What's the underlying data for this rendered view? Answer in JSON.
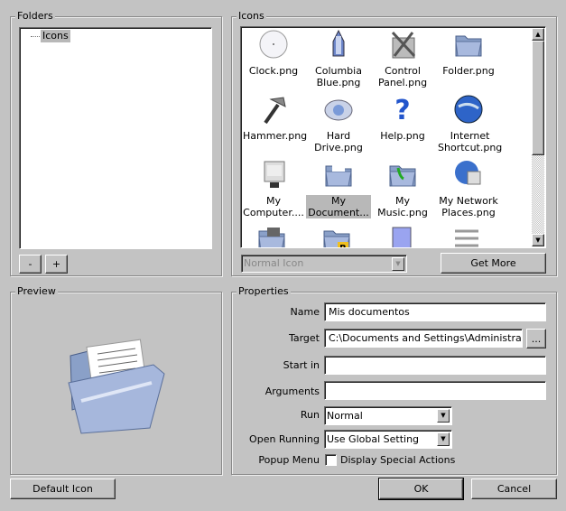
{
  "folders": {
    "title": "Folders",
    "tree": [
      "Icons"
    ],
    "remove_label": "-",
    "add_label": "+"
  },
  "icons": {
    "title": "Icons",
    "items": [
      {
        "label": "Clock.png",
        "icon": "clock-icon"
      },
      {
        "label": "Columbia Blue.png",
        "icon": "shuttle-icon"
      },
      {
        "label": "Control Panel.png",
        "icon": "control-panel-icon"
      },
      {
        "label": "Folder.png",
        "icon": "folder-icon"
      },
      {
        "label": "Hammer.png",
        "icon": "hammer-icon"
      },
      {
        "label": "Hard Drive.png",
        "icon": "hard-drive-icon"
      },
      {
        "label": "Help.png",
        "icon": "help-icon"
      },
      {
        "label": "Internet Shortcut.png",
        "icon": "globe-icon"
      },
      {
        "label": "My Computer....",
        "icon": "computer-icon"
      },
      {
        "label": "My Document...",
        "icon": "documents-folder-icon",
        "selected": true
      },
      {
        "label": "My Music.png",
        "icon": "music-folder-icon"
      },
      {
        "label": "My Network Places.png",
        "icon": "network-icon"
      },
      {
        "label": "",
        "icon": "pictures-folder-icon"
      },
      {
        "label": "",
        "icon": "r-folder-icon"
      },
      {
        "label": "",
        "icon": "notepad-icon"
      },
      {
        "label": "",
        "icon": "tools-icon"
      }
    ],
    "mode_select": "Normal Icon",
    "get_more_label": "Get More"
  },
  "preview": {
    "title": "Preview"
  },
  "properties": {
    "title": "Properties",
    "name_label": "Name",
    "name_value": "Mis documentos",
    "target_label": "Target",
    "target_value": "C:\\Documents and Settings\\Administrador\\M",
    "browse_label": "...",
    "startin_label": "Start in",
    "startin_value": "",
    "arguments_label": "Arguments",
    "arguments_value": "",
    "run_label": "Run",
    "run_value": "Normal",
    "open_running_label": "Open Running",
    "open_running_value": "Use Global Setting",
    "popup_label": "Popup Menu",
    "popup_checkbox_label": "Display Special Actions",
    "popup_checked": false
  },
  "footer": {
    "default_icon_label": "Default Icon",
    "ok_label": "OK",
    "cancel_label": "Cancel"
  }
}
